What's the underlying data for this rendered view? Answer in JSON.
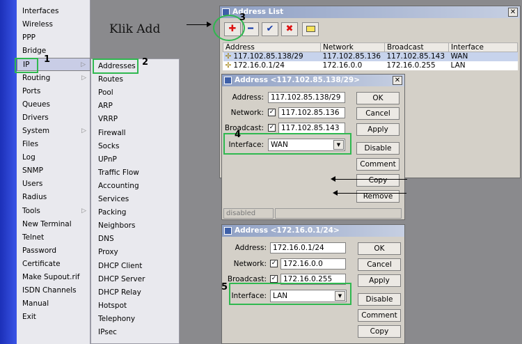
{
  "left_menu": [
    "Interfaces",
    "Wireless",
    "PPP",
    "Bridge",
    "IP",
    "Routing",
    "Ports",
    "Queues",
    "Drivers",
    "System",
    "Files",
    "Log",
    "SNMP",
    "Users",
    "Radius",
    "Tools",
    "New Terminal",
    "Telnet",
    "Password",
    "Certificate",
    "Make Supout.rif",
    "ISDN Channels",
    "Manual",
    "Exit"
  ],
  "submenu": [
    "Addresses",
    "Routes",
    "Pool",
    "ARP",
    "VRRP",
    "Firewall",
    "Socks",
    "UPnP",
    "Traffic Flow",
    "Accounting",
    "Services",
    "Packing",
    "Neighbors",
    "DNS",
    "Proxy",
    "DHCP Client",
    "DHCP Server",
    "DHCP Relay",
    "Hotspot",
    "Telephony",
    "IPsec"
  ],
  "address_list": {
    "title": "Address List",
    "toolbar_icons": [
      "add-icon",
      "remove-icon",
      "enable-icon",
      "disable-icon",
      "comment-icon"
    ],
    "columns": [
      "Address",
      "Network",
      "Broadcast",
      "Interface"
    ],
    "rows": [
      {
        "address": "117.102.85.138/29",
        "network": "117.102.85.136",
        "broadcast": "117.102.85.143",
        "interface": "WAN",
        "selected": true
      },
      {
        "address": "172.16.0.1/24",
        "network": "172.16.0.0",
        "broadcast": "172.16.0.255",
        "interface": "LAN",
        "selected": false
      }
    ]
  },
  "dialog1": {
    "title": "Address <117.102.85.138/29>",
    "address_label": "Address:",
    "address": "117.102.85.138/29",
    "network_label": "Network:",
    "network": "117.102.85.136",
    "broadcast_label": "Broadcast:",
    "broadcast": "117.102.85.143",
    "interface_label": "Interface:",
    "interface": "WAN",
    "buttons": [
      "OK",
      "Cancel",
      "Apply",
      "Disable",
      "Comment",
      "Copy",
      "Remove"
    ],
    "status": "disabled"
  },
  "dialog2": {
    "title": "Address <172.16.0.1/24>",
    "address_label": "Address:",
    "address": "172.16.0.1/24",
    "network_label": "Network:",
    "network": "172.16.0.0",
    "broadcast_label": "Broadcast:",
    "broadcast": "172.16.0.255",
    "interface_label": "Interface:",
    "interface": "LAN",
    "buttons": [
      "OK",
      "Cancel",
      "Apply",
      "Disable",
      "Comment",
      "Copy"
    ]
  },
  "annotations": {
    "klik_add": "Klik Add",
    "step1": "1",
    "step2": "2",
    "step3": "3",
    "step4": "4",
    "step5": "5",
    "highlight_color": "#2fb84f"
  }
}
